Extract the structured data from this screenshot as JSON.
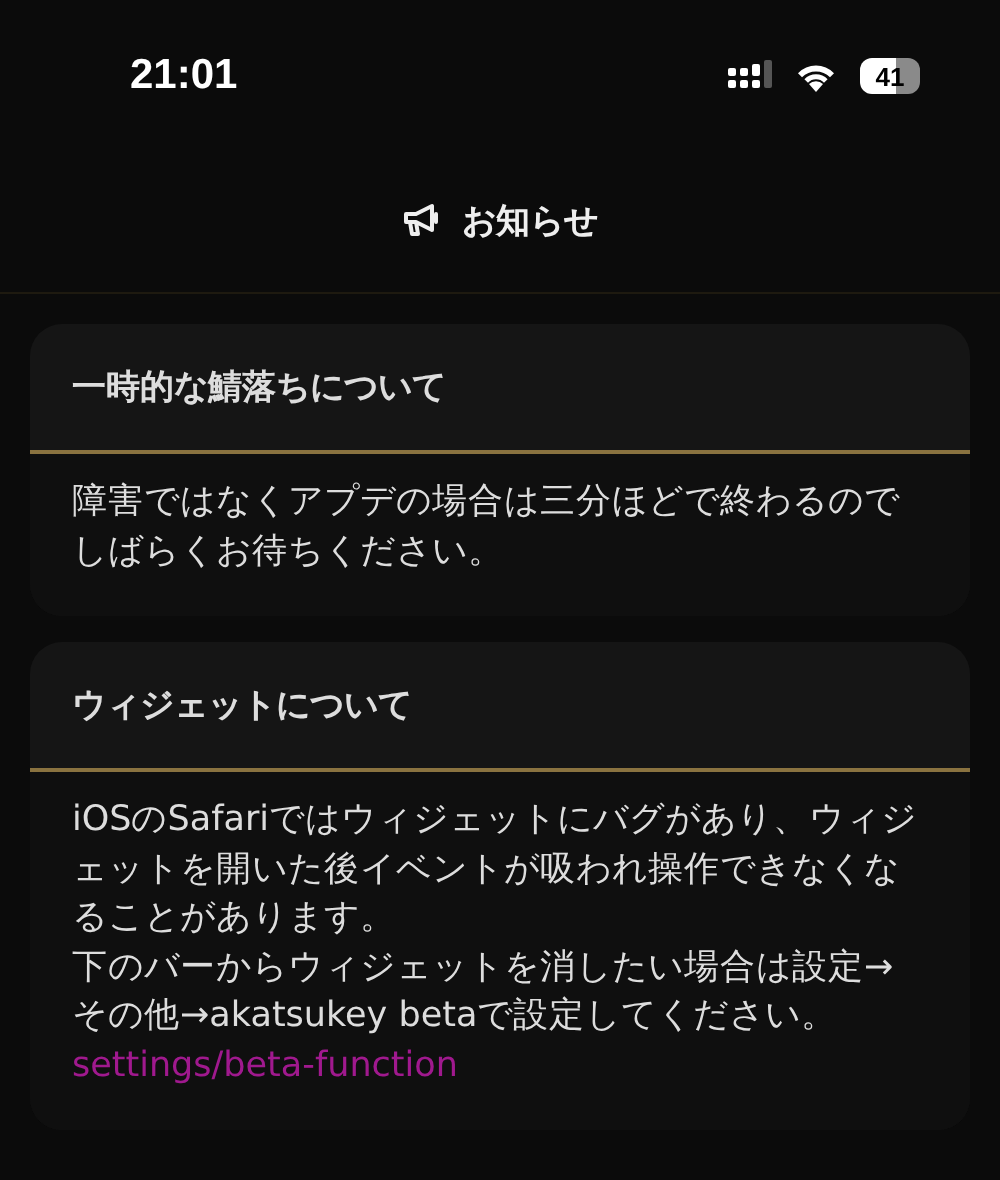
{
  "status_bar": {
    "time": "21:01",
    "battery": "41"
  },
  "header": {
    "title": "お知らせ"
  },
  "notices": [
    {
      "title": "一時的な鯖落ちについて",
      "paragraphs": [
        "障害ではなくアプデの場合は三分ほどで終わるのでしばらくお待ちください。"
      ]
    },
    {
      "title": "ウィジェットについて",
      "paragraphs": [
        "iOSのSafariではウィジェットにバグがあり、ウィジェットを開いた後イベントが吸われ操作できなくなることがあります。",
        "下のバーからウィジェットを消したい場合は設定→その他→akatsukey betaで設定してください。"
      ],
      "link": "settings/beta-function"
    }
  ]
}
